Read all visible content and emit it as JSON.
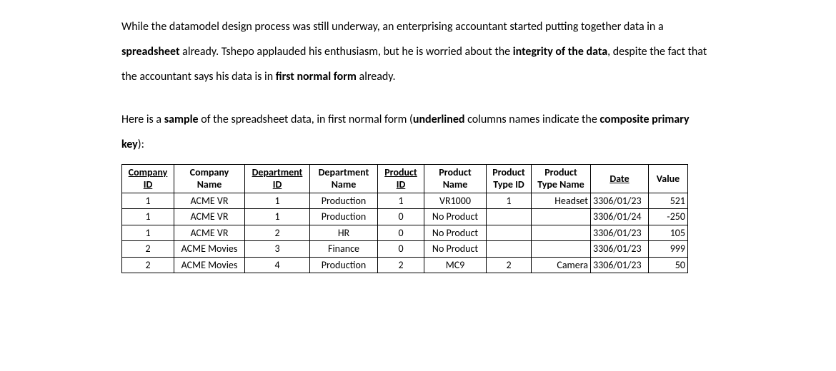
{
  "para1": {
    "t0": "While the datamodel design process was still underway, an enterprising accountant started putting together data in a ",
    "b0": "spreadsheet",
    "t1": " already. Tshepo applauded his enthusiasm, but he is worried about the ",
    "b1": "integrity of the data",
    "t2": ", despite the fact that the accountant says his data is in ",
    "b2": "first normal form",
    "t3": " already."
  },
  "para2": {
    "t0": "Here is a ",
    "b0": "sample",
    "t1": " of the spreadsheet data, in first normal form (",
    "b1": "underlined",
    "t2": " columns names indicate the ",
    "b2": "composite primary key",
    "t3": "):"
  },
  "table": {
    "headers": {
      "company_id_a": "Company",
      "company_id_b": "ID",
      "company_name_a": "Company",
      "company_name_b": "Name",
      "dept_id_a": "Department",
      "dept_id_b": "ID",
      "dept_name_a": "Department",
      "dept_name_b": "Name",
      "prod_id_a": "Product",
      "prod_id_b": "ID",
      "prod_name_a": "Product",
      "prod_name_b": "Name",
      "prod_type_id_a": "Product",
      "prod_type_id_b": "Type ID",
      "prod_type_name_a": "Product",
      "prod_type_name_b": "Type Name",
      "date": "Date",
      "value": "Value"
    },
    "rows": [
      {
        "cid": "1",
        "cname": "ACME VR",
        "did": "1",
        "dname": "Production",
        "pid": "1",
        "pname": "VR1000",
        "ptid": "1",
        "ptname": "Headset",
        "date": "3306/01/23",
        "value": "521"
      },
      {
        "cid": "1",
        "cname": "ACME VR",
        "did": "1",
        "dname": "Production",
        "pid": "0",
        "pname": "No Product",
        "ptid": "",
        "ptname": "",
        "date": "3306/01/24",
        "value": "-250"
      },
      {
        "cid": "1",
        "cname": "ACME VR",
        "did": "2",
        "dname": "HR",
        "pid": "0",
        "pname": "No Product",
        "ptid": "",
        "ptname": "",
        "date": "3306/01/23",
        "value": "105"
      },
      {
        "cid": "2",
        "cname": "ACME Movies",
        "did": "3",
        "dname": "Finance",
        "pid": "0",
        "pname": "No Product",
        "ptid": "",
        "ptname": "",
        "date": "3306/01/23",
        "value": "999"
      },
      {
        "cid": "2",
        "cname": "ACME Movies",
        "did": "4",
        "dname": "Production",
        "pid": "2",
        "pname": "MC9",
        "ptid": "2",
        "ptname": "Camera",
        "date": "3306/01/23",
        "value": "50"
      }
    ]
  }
}
